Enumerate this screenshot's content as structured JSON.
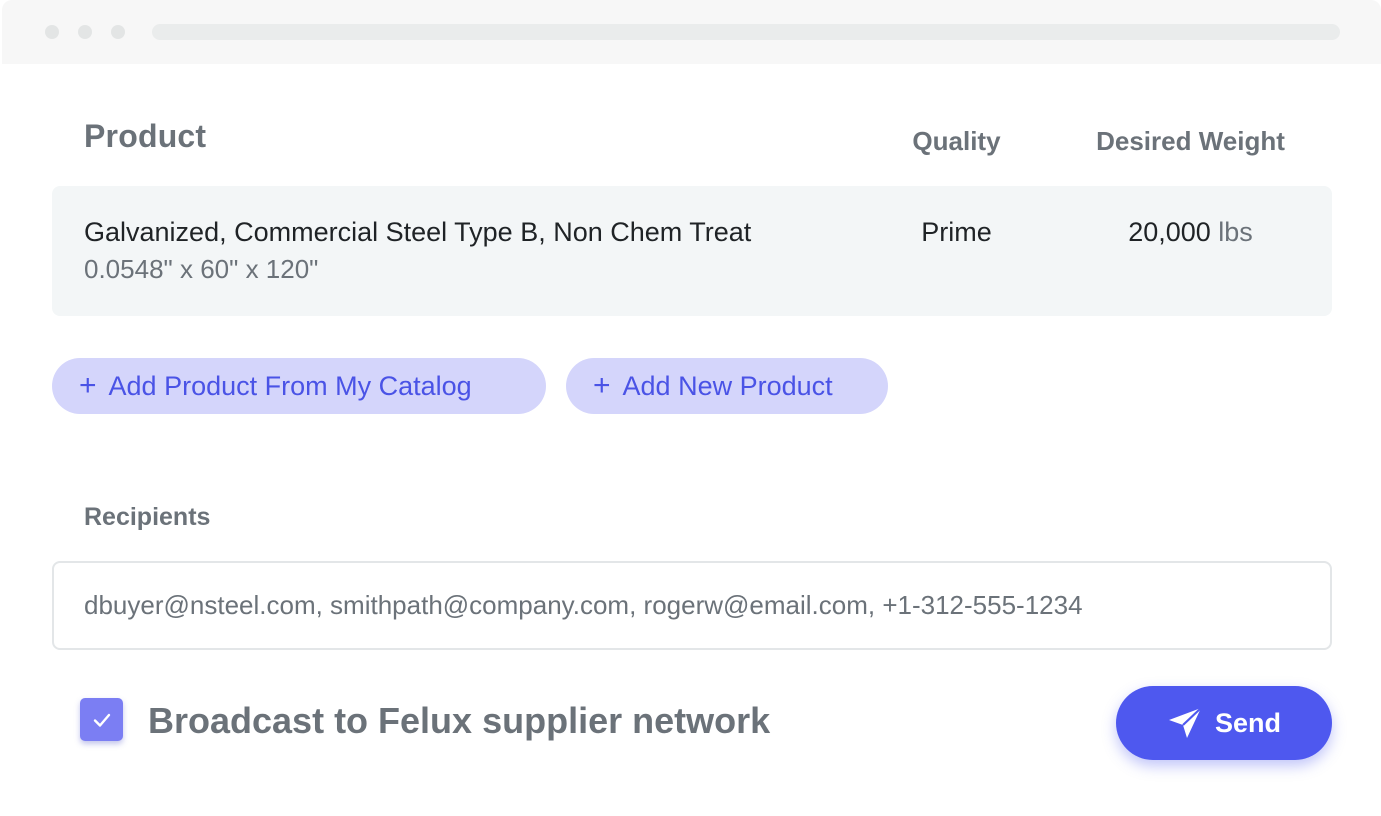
{
  "table": {
    "headers": {
      "product": "Product",
      "quality": "Quality",
      "weight": "Desired Weight"
    },
    "rows": [
      {
        "name": "Galvanized, Commercial Steel Type B, Non Chem Treat",
        "dimensions": "0.0548\" x 60\" x 120\"",
        "quality": "Prime",
        "weight_value": "20,000",
        "weight_unit": "lbs"
      }
    ]
  },
  "actions": {
    "add_from_catalog_label": "Add Product From My Catalog",
    "add_new_label": "Add New Product",
    "plus_glyph": "+"
  },
  "recipients": {
    "label": "Recipients",
    "value": "dbuyer@nsteel.com, smithpath@company.com, rogerw@email.com, +1-312-555-1234"
  },
  "broadcast": {
    "checked": true,
    "label": "Broadcast to Felux supplier network"
  },
  "send": {
    "label": "Send",
    "icon": "paper-plane-icon"
  },
  "colors": {
    "accent": "#4e58ef",
    "pill_bg": "#d4d5fb",
    "checkbox": "#7b7ef3",
    "text_dark": "#1f2326",
    "text_muted": "#6b7279",
    "row_bg": "#f3f6f7"
  }
}
